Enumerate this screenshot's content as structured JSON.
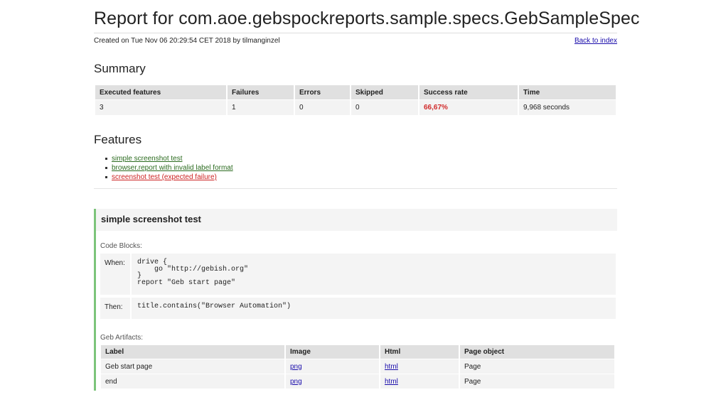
{
  "header": {
    "title": "Report for com.aoe.gebspockreports.sample.specs.GebSampleSpec",
    "meta": "Created on Tue Nov 06 20:29:54 CET 2018 by tilmanginzel",
    "back_link": "Back to index"
  },
  "summary": {
    "heading": "Summary",
    "columns": [
      "Executed features",
      "Failures",
      "Errors",
      "Skipped",
      "Success rate",
      "Time"
    ],
    "row": [
      "3",
      "1",
      "0",
      "0",
      "66,67%",
      "9,968 seconds"
    ],
    "rate_color": "#d12b2b"
  },
  "features": {
    "heading": "Features",
    "items": [
      {
        "label": "simple screenshot test",
        "status": "pass"
      },
      {
        "label": "browser.report with invalid label format",
        "status": "pass"
      },
      {
        "label": "screenshot test (expected failure)",
        "status": "fail"
      }
    ],
    "pass_color": "#2b6b1f",
    "fail_color": "#cc2222"
  },
  "feature_detail": {
    "title": "simple screenshot test",
    "status_bar_color": "#7cc47a",
    "code_label": "Code Blocks:",
    "blocks": [
      {
        "kind": "When:",
        "code": "drive {\n    go \"http://gebish.org\"\n}\nreport \"Geb start page\""
      },
      {
        "kind": "Then:",
        "code": "title.contains(\"Browser Automation\")"
      }
    ],
    "artifacts_label": "Geb Artifacts:",
    "artifact_columns": [
      "Label",
      "Image",
      "Html",
      "Page object"
    ],
    "artifacts": [
      {
        "label": "Geb start page",
        "image": "png",
        "html": "html",
        "page_object": "Page"
      },
      {
        "label": "end",
        "image": "png",
        "html": "html",
        "page_object": "Page"
      }
    ]
  }
}
